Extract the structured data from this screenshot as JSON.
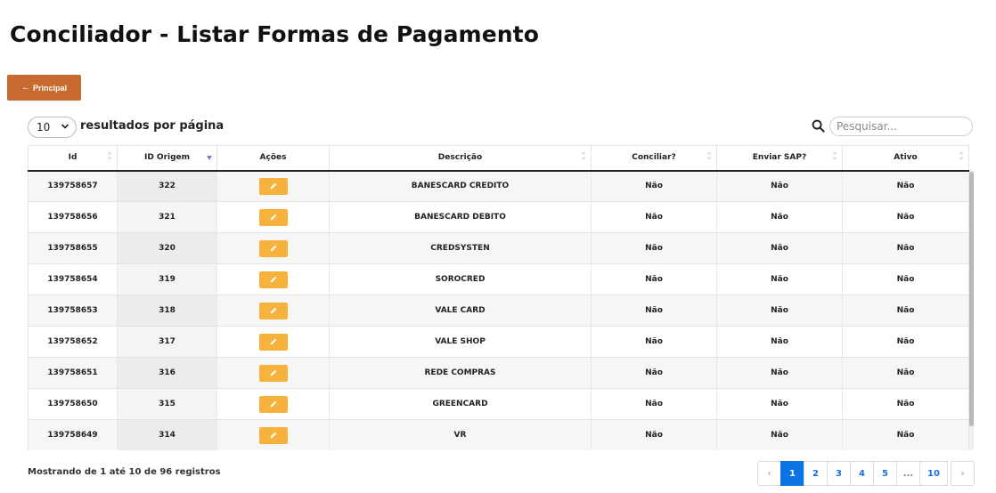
{
  "header": {
    "title": "Conciliador - Listar Formas de Pagamento"
  },
  "toolbar": {
    "back_label": "Principal",
    "back_icon": "arrow-left-icon"
  },
  "length": {
    "value": "10",
    "label": "resultados por página"
  },
  "search": {
    "placeholder": "Pesquisar...",
    "icon": "search-icon"
  },
  "table": {
    "columns": [
      "Id",
      "ID Origem",
      "Ações",
      "Descrição",
      "Conciliar?",
      "Enviar SAP?",
      "Ativo"
    ],
    "sorted_column": "ID Origem",
    "rows": [
      {
        "id": "139758657",
        "origem": "322",
        "descricao": "BANESCARD CREDITO",
        "conciliar": "Não",
        "enviar": "Não",
        "ativo": "Não"
      },
      {
        "id": "139758656",
        "origem": "321",
        "descricao": "BANESCARD DEBITO",
        "conciliar": "Não",
        "enviar": "Não",
        "ativo": "Não"
      },
      {
        "id": "139758655",
        "origem": "320",
        "descricao": "CREDSYSTEN",
        "conciliar": "Não",
        "enviar": "Não",
        "ativo": "Não"
      },
      {
        "id": "139758654",
        "origem": "319",
        "descricao": "SOROCRED",
        "conciliar": "Não",
        "enviar": "Não",
        "ativo": "Não"
      },
      {
        "id": "139758653",
        "origem": "318",
        "descricao": "VALE CARD",
        "conciliar": "Não",
        "enviar": "Não",
        "ativo": "Não"
      },
      {
        "id": "139758652",
        "origem": "317",
        "descricao": "VALE SHOP",
        "conciliar": "Não",
        "enviar": "Não",
        "ativo": "Não"
      },
      {
        "id": "139758651",
        "origem": "316",
        "descricao": "REDE COMPRAS",
        "conciliar": "Não",
        "enviar": "Não",
        "ativo": "Não"
      },
      {
        "id": "139758650",
        "origem": "315",
        "descricao": "GREENCARD",
        "conciliar": "Não",
        "enviar": "Não",
        "ativo": "Não"
      },
      {
        "id": "139758649",
        "origem": "314",
        "descricao": "VR",
        "conciliar": "Não",
        "enviar": "Não",
        "ativo": "Não"
      }
    ]
  },
  "footer": {
    "info": "Mostrando de 1 até 10 de 96 registros",
    "pages": [
      "1",
      "2",
      "3",
      "4",
      "5",
      "...",
      "10"
    ],
    "current_page": "1",
    "prev": "‹",
    "next": "›"
  },
  "colors": {
    "back_button": "#c8692f",
    "edit_button": "#f7b23b",
    "active_page": "#0b73e4"
  }
}
